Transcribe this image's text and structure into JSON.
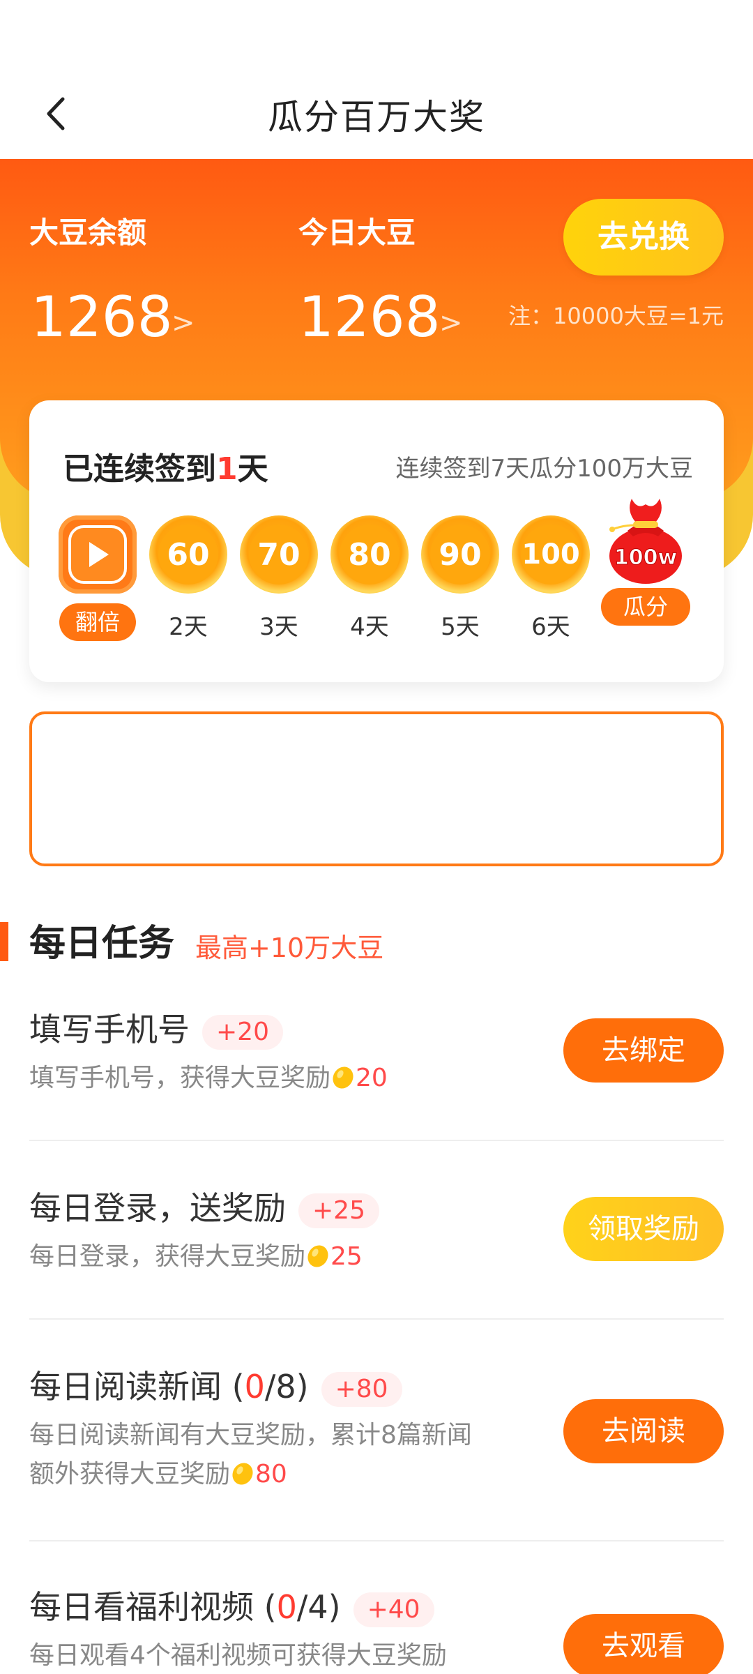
{
  "header": {
    "title": "瓜分百万大奖"
  },
  "balance": {
    "total_label": "大豆余额",
    "total_value": "1268",
    "today_label": "今日大豆",
    "today_value": "1268",
    "arrow": ">",
    "exchange_label": "去兑换",
    "rate_note": "注：10000大豆=1元"
  },
  "signin": {
    "title_prefix": "已连续签到",
    "days": "1",
    "title_suffix": "天",
    "hint": "连续签到7天瓜分100万大豆",
    "double_label": "翻倍",
    "days_list": [
      {
        "value": "60",
        "label": "2天"
      },
      {
        "value": "70",
        "label": "3天"
      },
      {
        "value": "80",
        "label": "4天"
      },
      {
        "value": "90",
        "label": "5天"
      },
      {
        "value": "100",
        "label": "6天"
      }
    ],
    "bag_text": "100w",
    "bag_label": "瓜分"
  },
  "tasks": {
    "heading": "每日任务",
    "subheading": "最高+10万大豆",
    "items": [
      {
        "title": "填写手机号",
        "badge": "+20",
        "desc": "填写手机号，获得大豆奖励",
        "reward": "20",
        "button": "去绑定"
      },
      {
        "title": "每日登录，送奖励",
        "badge": "+25",
        "desc": "每日登录，获得大豆奖励",
        "reward": "25",
        "button": "领取奖励"
      },
      {
        "title_prefix": "每日阅读新闻 (",
        "progress": "0",
        "title_suffix": "/8)",
        "badge": "+80",
        "desc_line1": "每日阅读新闻有大豆奖励，累计8篇新闻",
        "desc_line2": "额外获得大豆奖励",
        "reward": "80",
        "button": "去阅读"
      },
      {
        "title_prefix": "每日看福利视频 (",
        "progress": "0",
        "title_suffix": "/4)",
        "badge": "+40",
        "desc": "每日观看4个福利视频可获得大豆奖励",
        "button": "去观看"
      }
    ]
  }
}
